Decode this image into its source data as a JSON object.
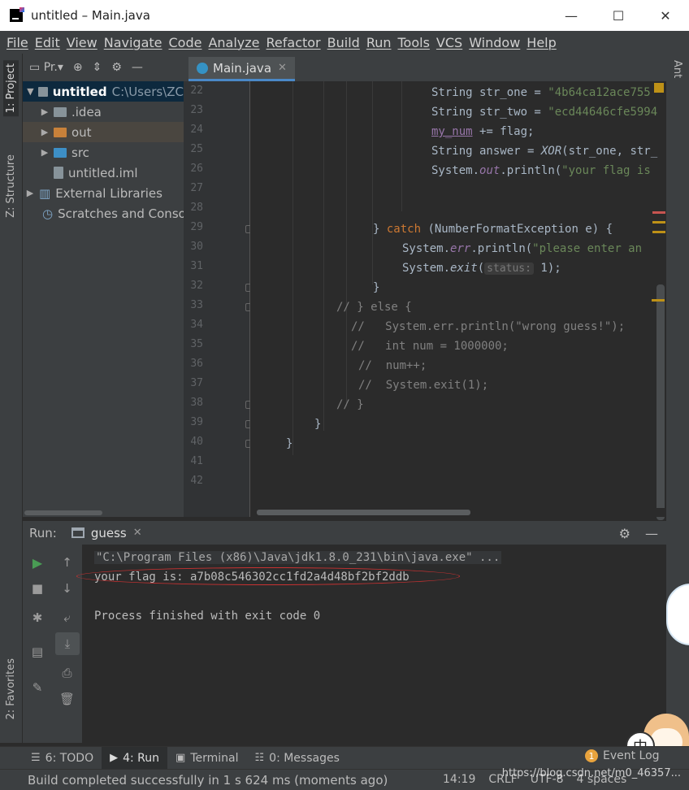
{
  "window": {
    "title": "untitled – Main.java",
    "controls": [
      "—",
      "☐",
      "✕"
    ]
  },
  "menu": [
    "File",
    "Edit",
    "View",
    "Navigate",
    "Code",
    "Analyze",
    "Refactor",
    "Build",
    "Run",
    "Tools",
    "VCS",
    "Window",
    "Help"
  ],
  "left_stripe": {
    "project_tab": "1: Project",
    "structure_tab": "Z: Structure",
    "favorites_tab": "2: Favorites"
  },
  "right_stripe": {
    "ant_tab": "Ant"
  },
  "project_panel": {
    "selector": "Pr.",
    "tree": [
      {
        "label": "untitled",
        "path": "C:\\Users\\ZC",
        "selected": true
      },
      {
        "label": ".idea"
      },
      {
        "label": "out",
        "highlighted": true
      },
      {
        "label": "src"
      },
      {
        "label": "untitled.iml"
      },
      {
        "label": "External Libraries"
      },
      {
        "label": "Scratches and Consoles"
      }
    ]
  },
  "editor": {
    "tab_label": "Main.java",
    "line_numbers": [
      "22",
      "23",
      "24",
      "25",
      "26",
      "27",
      "28",
      "29",
      "30",
      "31",
      "32",
      "33",
      "34",
      "35",
      "36",
      "37",
      "38",
      "39",
      "40",
      "41",
      "42"
    ],
    "code": {
      "l22a": "String str_one = ",
      "l22b": "\"4b64ca12ace755",
      "l23a": "String str_two = ",
      "l23b": "\"ecd44646cfe5994",
      "l24a": "my_num",
      "l24b": " += flag;",
      "l25a": "String answer = ",
      "l25b": "XOR",
      "l25c": "(str_one, str_",
      "l26a": "System.",
      "l26b": "out",
      "l26c": ".println(",
      "l26d": "\"your flag is",
      "l29a": "} ",
      "l29b": "catch",
      "l29c": " (NumberFormatException e) {",
      "l30a": "System.",
      "l30b": "err",
      "l30c": ".println(",
      "l30d": "\"please enter an",
      "l31a": "System.",
      "l31b": "exit",
      "l31c": "(",
      "l31hint": "status:",
      "l31d": " 1);",
      "l32": "}",
      "l33": "// } else {",
      "l34": "//   System.err.println(\"wrong guess!\");",
      "l35": "//   int num = 1000000;",
      "l36": "//  num++;",
      "l37": "//  System.exit(1);",
      "l38": "// }",
      "l39": "}",
      "l40": "}"
    }
  },
  "run_panel": {
    "title": "Run:",
    "tab_label": "guess",
    "console": {
      "command": "\"C:\\Program Files (x86)\\Java\\jdk1.8.0_231\\bin\\java.exe\" ...",
      "flag_line": "your flag is: a7b08c546302cc1fd2a4d48bf2bf2ddb",
      "exit_line": "Process finished with exit code 0"
    }
  },
  "bottom_tabs": {
    "todo": "6: TODO",
    "run": "4: Run",
    "terminal": "Terminal",
    "messages": "0: Messages",
    "event_log": "Event Log",
    "event_count": "1"
  },
  "status_bar": {
    "message": "Build completed successfully in 1 s 624 ms (moments ago)",
    "position": "14:19",
    "line_sep": "CRLF",
    "encoding": "UTF-8",
    "indent": "4 spaces"
  },
  "watermark": "https://blog.csdn.net/m0_46357...",
  "mascot_char": "中",
  "colors": {
    "accent": "#4a88c7",
    "keyword": "#cc7832",
    "string": "#6a8759",
    "field": "#9876aa",
    "annotation_ellipse": "#c93232"
  }
}
